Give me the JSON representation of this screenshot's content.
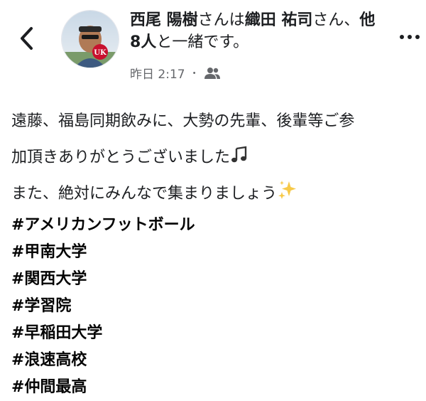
{
  "header": {
    "author": "西尾 陽樹",
    "connector_1": "さんは",
    "tagged_person": "織田 祐司",
    "connector_2": "さん、",
    "others": "他8人",
    "connector_3": "と一緒です。",
    "time": "昨日 2:17",
    "separator": "・",
    "audience_icon": "friends-icon"
  },
  "avatar": {
    "badge_text": "UK"
  },
  "post": {
    "line1": "遠藤、福島同期飲みに、大勢の先輩、後輩等ご参",
    "line2": "加頂きありがとうございました",
    "line3": "また、絶対にみんなで集まりましょう",
    "emoji_1": "music-note-icon",
    "emoji_2": "sparkles-icon",
    "hashtags": [
      "#アメリカンフットボール",
      "#甲南大学",
      "#関西大学",
      "#学習院",
      "#早稲田大学",
      "#浪速高校",
      "#仲間最高"
    ]
  }
}
